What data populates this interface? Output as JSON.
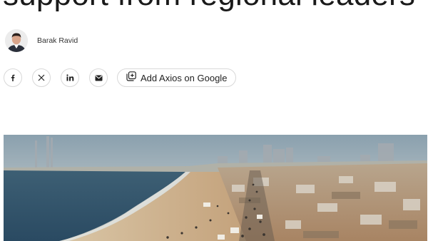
{
  "article": {
    "headline": "support from regional leaders",
    "author": "Barak Ravid"
  },
  "share": {
    "facebook_icon": "facebook-icon",
    "x_icon": "x-icon",
    "linkedin_icon": "linkedin-icon",
    "email_icon": "email-icon",
    "google_label": "Add Axios on Google",
    "google_icon": "add-square-icon"
  }
}
